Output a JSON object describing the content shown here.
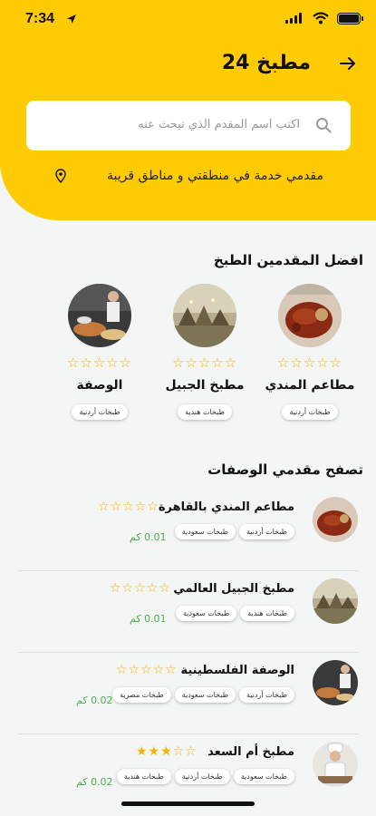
{
  "status": {
    "time": "7:34"
  },
  "header": {
    "title": "مطبخ 24",
    "search_placeholder": "اكتب اسم المقدم الذي تبحث عنه",
    "location_text": "مقدمي خدمة في منطقتي و مناطق قريبة"
  },
  "top_section": {
    "title": "افضل المقدمين الطبخ",
    "cards": [
      {
        "name": "مطاعم المندي",
        "stars": "☆☆☆☆☆",
        "tag": "طبخات أردنية"
      },
      {
        "name": "مطبخ الجبيل",
        "stars": "☆☆☆☆☆",
        "tag": "طبخات هندية"
      },
      {
        "name": "الوصفة",
        "stars": "☆☆☆☆☆",
        "tag": "طبخات أردنية"
      }
    ]
  },
  "browse_section": {
    "title": "تصفح مقدمي الوصفات",
    "rows": [
      {
        "name": "مطاعم المندي بالقاهرة",
        "stars": "☆☆☆☆☆",
        "tags": [
          "طبخات أردنية",
          "طبخات سعودية"
        ],
        "distance": "0.01 كم"
      },
      {
        "name": "مطبخ الجبيل العالمي",
        "stars": "☆☆☆☆☆",
        "tags": [
          "طبخات هندية",
          "طبخات سعودية"
        ],
        "distance": "0.01 كم"
      },
      {
        "name": "الوصفة الفلسطينية",
        "stars": "☆☆☆☆☆",
        "tags": [
          "طبخات أردنية",
          "طبخات سعودية",
          "طبخات مصرية"
        ],
        "distance": "0.02 كم"
      },
      {
        "name": "مطبخ أم السعد",
        "stars": "★★★☆☆",
        "tags": [
          "طبخات سعودية",
          "طبخات أردنية",
          "طبخات هندية"
        ],
        "distance": "0.02 كم"
      }
    ]
  },
  "colors": {
    "accent": "#ffcb05",
    "star": "#f5b301",
    "distance": "#4caf50"
  },
  "icons": [
    "location-arrow-icon",
    "signal-icon",
    "wifi-icon",
    "battery-icon",
    "back-arrow-icon",
    "search-icon",
    "map-pin-icon"
  ]
}
